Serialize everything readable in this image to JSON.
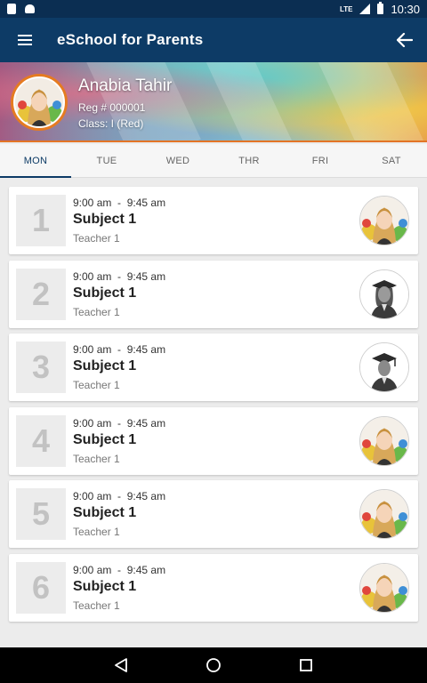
{
  "status_bar": {
    "network": "LTE",
    "time": "10:30"
  },
  "app_bar": {
    "title": "eSchool for Parents"
  },
  "profile": {
    "name": "Anabia Tahir",
    "reg": "Reg # 000001",
    "class": "Class: I (Red)"
  },
  "tabs": [
    {
      "label": "MON",
      "active": true
    },
    {
      "label": "TUE",
      "active": false
    },
    {
      "label": "WED",
      "active": false
    },
    {
      "label": "THR",
      "active": false
    },
    {
      "label": "FRI",
      "active": false
    },
    {
      "label": "SAT",
      "active": false
    }
  ],
  "periods": [
    {
      "number": "1",
      "start": "9:00 am",
      "sep": "-",
      "end": "9:45 am",
      "subject": "Subject 1",
      "teacher": "Teacher 1",
      "avatar": "girl-photo"
    },
    {
      "number": "2",
      "start": "9:00 am",
      "sep": "-",
      "end": "9:45 am",
      "subject": "Subject 1",
      "teacher": "Teacher 1",
      "avatar": "graduate-female-icon"
    },
    {
      "number": "3",
      "start": "9:00 am",
      "sep": "-",
      "end": "9:45 am",
      "subject": "Subject 1",
      "teacher": "Teacher 1",
      "avatar": "graduate-male-icon"
    },
    {
      "number": "4",
      "start": "9:00 am",
      "sep": "-",
      "end": "9:45 am",
      "subject": "Subject 1",
      "teacher": "Teacher 1",
      "avatar": "girl-photo"
    },
    {
      "number": "5",
      "start": "9:00 am",
      "sep": "-",
      "end": "9:45 am",
      "subject": "Subject 1",
      "teacher": "Teacher 1",
      "avatar": "girl-photo"
    },
    {
      "number": "6",
      "start": "9:00 am",
      "sep": "-",
      "end": "9:45 am",
      "subject": "Subject 1",
      "teacher": "Teacher 1",
      "avatar": "girl-photo"
    }
  ],
  "colors": {
    "primary": "#0d3b66",
    "accent": "#e37426"
  }
}
